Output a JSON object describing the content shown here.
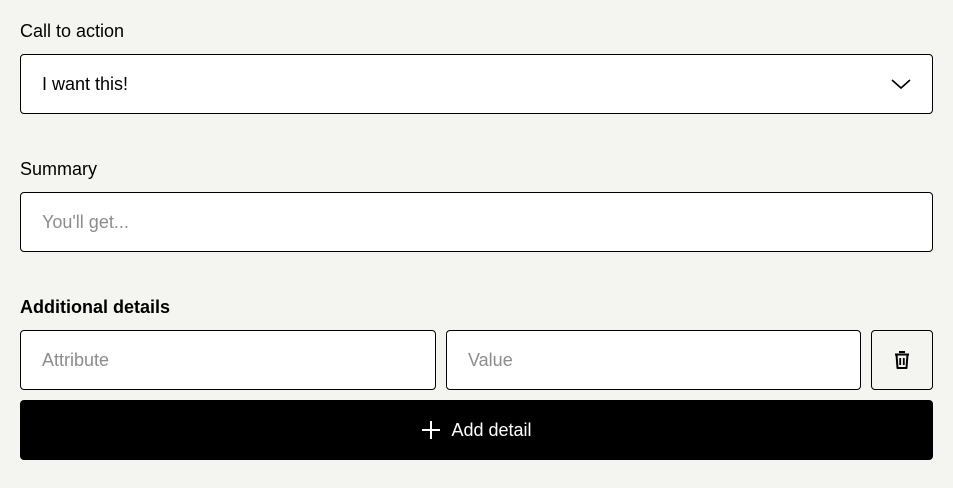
{
  "call_to_action": {
    "label": "Call to action",
    "selected_value": "I want this!",
    "icon": "chevron-down-icon"
  },
  "summary": {
    "label": "Summary",
    "placeholder": "You'll get..."
  },
  "additional_details": {
    "heading": "Additional details",
    "attribute_placeholder": "Attribute",
    "value_placeholder": "Value",
    "delete_icon": "trash-icon",
    "add_button_label": "Add detail",
    "add_icon": "plus-icon"
  },
  "colors": {
    "background": "#f4f4f0",
    "field_background": "#ffffff",
    "border": "#000000",
    "placeholder": "#8c8c8c",
    "primary_button": "#000000",
    "primary_button_text": "#ffffff"
  }
}
